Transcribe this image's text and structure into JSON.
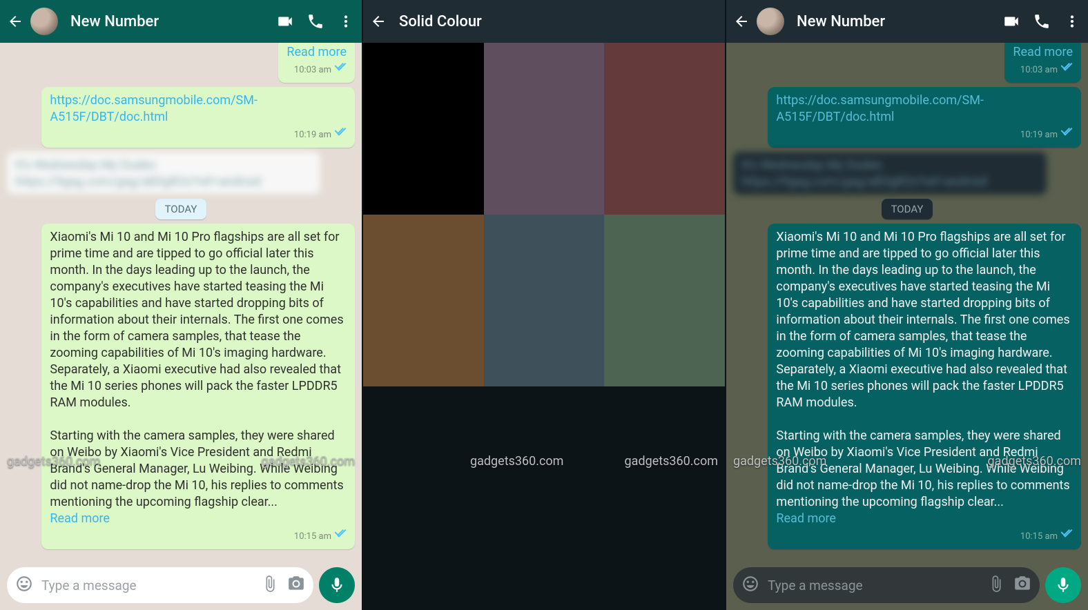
{
  "header": {
    "title_light": "New Number",
    "title_dark": "New Number",
    "solid_title": "Solid Colour"
  },
  "msgs": {
    "rm_trunc": "Read more",
    "t1": "10:03 am",
    "url": "https://doc.samsungmobile.com/SM-A515F/DBT/doc.html",
    "t2": "10:19 am",
    "today": "TODAY",
    "body1": "Xiaomi's Mi 10 and Mi 10 Pro flagships are all set for prime time and are tipped to go official later this month. In the days leading up to the launch, the company's executives have started teasing the Mi 10's capabilities and have started dropping bits of information about their internals. The first one comes in the form of camera samples, that tease the zooming capabilities of Mi 10's imaging hardware. Separately, a Xiaomi executive had also revealed that the Mi 10 series phones will pack the faster LPDDR5 RAM modules.",
    "body2_light": "Starting with the camera samples, they were shared on Weibo by Xiaomi's Vice President and Redmi Brand's General Manager, Lu Weibing. While Weibing did not name-drop the Mi 10, his replies to comments mentioning the upcoming flagship clear...",
    "body2_dark": "Starting with the camera samples, they were shared on Weibo by Xiaomi's Vice President and Redmi Brand's General Manager, Lu Weibing. While Weibing did not name-drop the Mi 10, his replies to comments mentioning the upcoming flagship clear...",
    "rm": "Read more",
    "t3": "10:15 am"
  },
  "compose": {
    "placeholder": "Type a message"
  },
  "swatches": [
    "#000000",
    "#5e4e5e",
    "#653a3a",
    "#6b4e2f",
    "#3e515a",
    "#4d6453",
    "#0d1418",
    "#0d1418",
    "#0d1418"
  ],
  "wm": "gadgets360.com"
}
